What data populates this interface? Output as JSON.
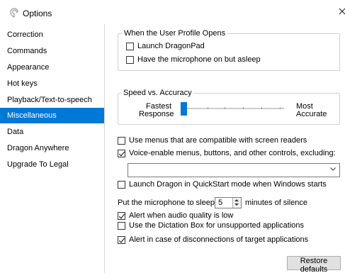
{
  "window": {
    "title": "Options"
  },
  "sidebar": {
    "items": [
      {
        "label": "Correction",
        "selected": false
      },
      {
        "label": "Commands",
        "selected": false
      },
      {
        "label": "Appearance",
        "selected": false
      },
      {
        "label": "Hot keys",
        "selected": false
      },
      {
        "label": "Playback/Text-to-speech",
        "selected": false
      },
      {
        "label": "Miscellaneous",
        "selected": true
      },
      {
        "label": "Data",
        "selected": false
      },
      {
        "label": "Dragon Anywhere",
        "selected": false
      },
      {
        "label": "Upgrade To Legal",
        "selected": false
      }
    ]
  },
  "profile_group": {
    "title": "When the User Profile Opens",
    "launch_dragonpad": {
      "label": "Launch DragonPad",
      "checked": false
    },
    "mic_asleep": {
      "label": "Have the microphone on but asleep",
      "checked": false
    }
  },
  "speed_group": {
    "title": "Speed vs. Accuracy",
    "left_label_line1": "Fastest",
    "left_label_line2": "Response",
    "right_label_line1": "Most",
    "right_label_line2": "Accurate",
    "slider_position": 0.0,
    "tick_count": 6
  },
  "options": {
    "screen_readers": {
      "label": "Use menus that are compatible with screen readers",
      "checked": false
    },
    "voice_enable": {
      "label": "Voice-enable menus, buttons, and other controls, excluding:",
      "checked": true
    },
    "exclusion_value": "",
    "quickstart": {
      "label": "Launch Dragon in QuickStart mode when Windows starts",
      "checked": false
    },
    "sleep_prefix": "Put the microphone to sleep after",
    "sleep_minutes": "5",
    "sleep_suffix": "minutes of silence",
    "alert_audio": {
      "label": "Alert when audio quality is low",
      "checked": true
    },
    "dictation_box": {
      "label": "Use the Dictation Box for unsupported applications",
      "checked": false
    },
    "alert_disconnect": {
      "label": "Alert in case of disconnections of target applications",
      "checked": true
    }
  },
  "buttons": {
    "restore_defaults": "Restore defaults"
  },
  "colors": {
    "accent": "#0078d7",
    "selected_text": "#ffffff"
  }
}
